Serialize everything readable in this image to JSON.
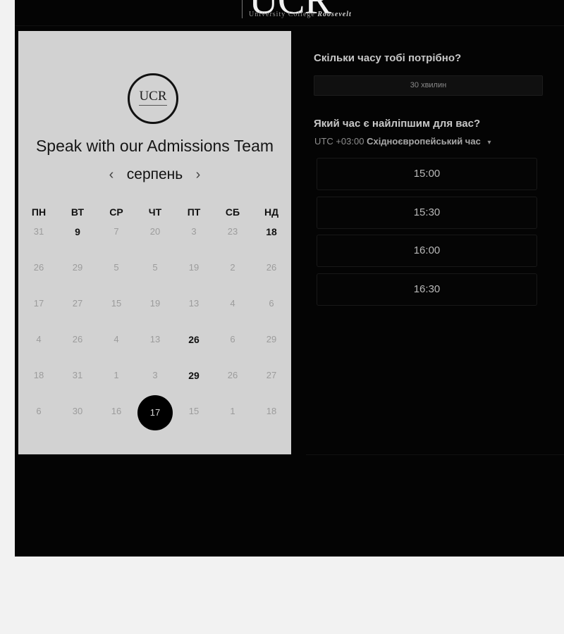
{
  "header": {
    "logo_text": "UCR",
    "logo_subtitle": "University College",
    "logo_subtitle_italic": "Roosevelt"
  },
  "calendar_panel": {
    "logo_text": "UCR",
    "title": "Speak with our Admissions Team",
    "month": "серпень",
    "prev_arrow": "‹",
    "next_arrow": "›",
    "weekdays": [
      "ПН",
      "ВТ",
      "СР",
      "ЧТ",
      "ПТ",
      "СБ",
      "НД"
    ],
    "weeks": [
      [
        "31",
        "9",
        "7",
        "20",
        "3",
        "23",
        "18"
      ],
      [
        "26",
        "29",
        "5",
        "5",
        "19",
        "2",
        "26"
      ],
      [
        "17",
        "27",
        "15",
        "19",
        "13",
        "4",
        "6"
      ],
      [
        "4",
        "26",
        "4",
        "13",
        "26",
        "6",
        "29"
      ],
      [
        "18",
        "31",
        "1",
        "3",
        "29",
        "26",
        "27"
      ],
      [
        "6",
        "30",
        "16",
        "17",
        "15",
        "1",
        "18"
      ]
    ],
    "available_days": [
      "9",
      "18",
      "26",
      "29"
    ],
    "selected_day": "17"
  },
  "booking": {
    "duration_question": "Скільки часу тобі потрібно?",
    "duration_value": "30 хвилин",
    "time_question": "Який час є найліпшим для вас?",
    "timezone_offset": "UTC +03:00",
    "timezone_name": "Східноєвропейський час",
    "timezone_caret": "▾",
    "slots": [
      "15:00",
      "15:30",
      "16:00",
      "16:30"
    ]
  }
}
